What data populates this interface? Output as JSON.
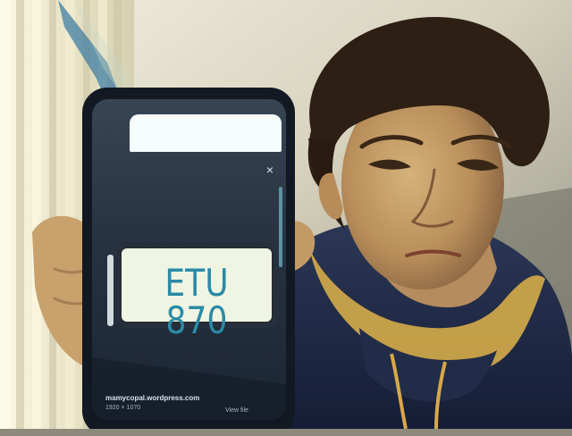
{
  "scene": {
    "colors": {
      "wall": "#d8d3be",
      "curtain": "#ebe6c9",
      "hoodie": "#1f2c49",
      "hoodie_lining": "#d6ac49",
      "skin": "#c49b66",
      "hair": "#2d1f14",
      "phone_frame": "#131923",
      "phone_screen": "#283443"
    }
  },
  "phone": {
    "close_icon": "×",
    "plate_text": "ETU 870",
    "plate_top_text": "",
    "source_url": "mamycopal.wordpress.com",
    "image_dimensions": "1920 × 1070",
    "view_file_label": "View file"
  }
}
